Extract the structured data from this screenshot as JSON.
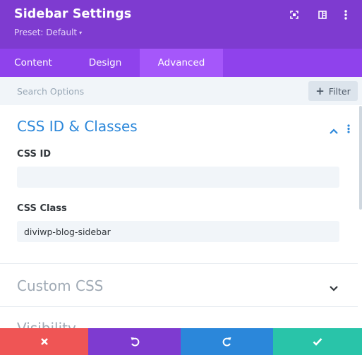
{
  "header": {
    "title": "Sidebar Settings",
    "preset": "Preset: Default",
    "preset_caret": "▾",
    "icons": [
      "fullscreen-icon",
      "split-view-icon",
      "more-vertical-icon"
    ]
  },
  "tabs": [
    {
      "label": "Content",
      "active": false
    },
    {
      "label": "Design",
      "active": false
    },
    {
      "label": "Advanced",
      "active": true
    }
  ],
  "search": {
    "placeholder": "Search Options",
    "filter_label": "Filter",
    "filter_icon": "plus-icon"
  },
  "sections": {
    "css_id_classes": {
      "title": "CSS ID & Classes",
      "expanded": true,
      "fields": {
        "css_id": {
          "label": "CSS ID",
          "value": ""
        },
        "css_class": {
          "label": "CSS Class",
          "value": "diviwp-blog-sidebar"
        }
      }
    },
    "custom_css": {
      "title": "Custom CSS",
      "expanded": false
    },
    "visibility": {
      "title": "Visibility",
      "expanded": false
    }
  },
  "footer": {
    "buttons": [
      {
        "icon": "close-icon",
        "color": "#ef5555"
      },
      {
        "icon": "undo-icon",
        "color": "#7e3bd0"
      },
      {
        "icon": "redo-icon",
        "color": "#2b87da"
      },
      {
        "icon": "check-icon",
        "color": "#29c4a9"
      }
    ]
  },
  "colors": {
    "header": "#7e3bd0",
    "tabs": "#8f42ec",
    "active_tab": "#a557fa",
    "accent": "#2b87da"
  }
}
